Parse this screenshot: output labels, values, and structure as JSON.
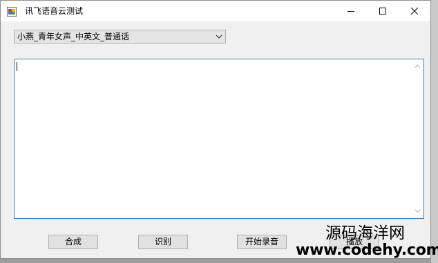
{
  "window": {
    "title": "讯飞语音云测试",
    "app_icon": "form-app-icon",
    "controls": [
      "minimize-icon",
      "maximize-icon",
      "close-icon"
    ]
  },
  "voice_select": {
    "selected": "小燕_青年女声_中英文_普通话"
  },
  "text_area": {
    "value": ""
  },
  "buttons": {
    "synthesize": "合成",
    "recognize": "识别",
    "start_record": "开始录音",
    "play": "播放"
  },
  "watermark": {
    "line1": "源码海洋网",
    "line2": "www.codehy.com"
  },
  "colors": {
    "window_bg": "#f0f0f0",
    "textarea_border": "#3c7fb1",
    "button_bg": "#e1e1e1",
    "button_border": "#adadad"
  }
}
